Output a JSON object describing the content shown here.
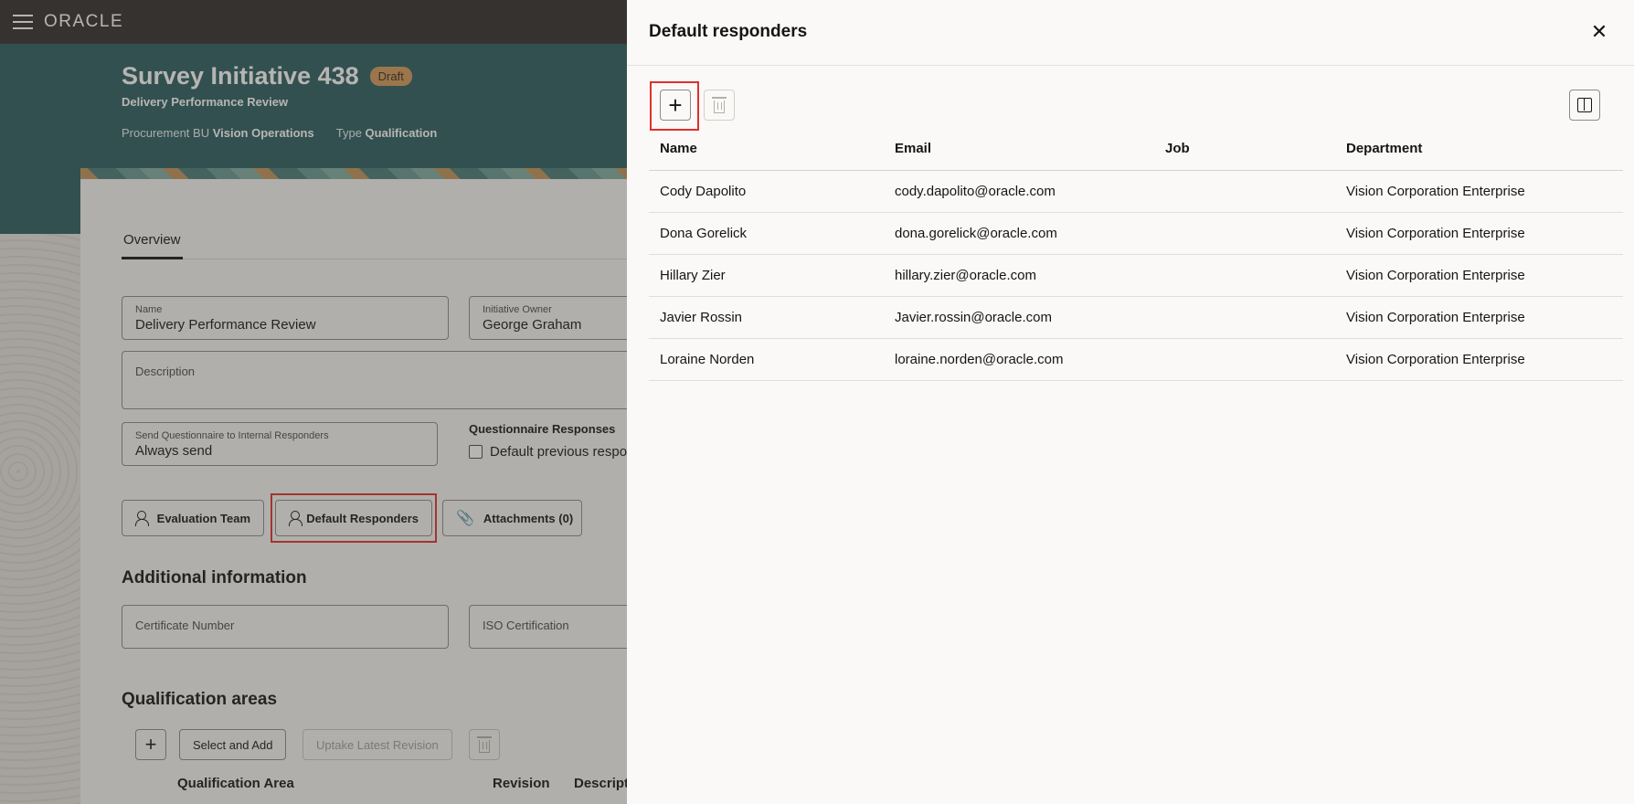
{
  "app": {
    "brand": "ORACLE"
  },
  "header": {
    "title": "Survey Initiative 438",
    "status": "Draft",
    "subtitle": "Delivery Performance Review",
    "meta": [
      {
        "label": "Procurement BU",
        "value": "Vision Operations"
      },
      {
        "label": "Type",
        "value": "Qualification"
      }
    ]
  },
  "tabs": [
    {
      "label": "Overview"
    }
  ],
  "form": {
    "name": {
      "label": "Name",
      "value": "Delivery Performance Review"
    },
    "owner": {
      "label": "Initiative Owner",
      "value": "George Graham"
    },
    "description": {
      "label": "Description"
    },
    "send": {
      "label": "Send Questionnaire to Internal Responders",
      "value": "Always send"
    },
    "responses": {
      "label": "Questionnaire Responses",
      "checkbox": "Default previous respo"
    }
  },
  "actions": {
    "evaluation_team": "Evaluation Team",
    "default_responders": "Default Responders",
    "attachments": "Attachments (0)"
  },
  "additional": {
    "title": "Additional information",
    "certificate": "Certificate Number",
    "iso": "ISO Certification"
  },
  "qualification": {
    "title": "Qualification areas",
    "select_add": "Select and Add",
    "uptake": "Uptake Latest Revision",
    "columns": [
      "Qualification Area",
      "Revision",
      "Descript"
    ]
  },
  "drawer": {
    "title": "Default responders",
    "columns": [
      "Name",
      "Email",
      "Job",
      "Department"
    ],
    "rows": [
      {
        "name": "Cody Dapolito",
        "email": "cody.dapolito@oracle.com",
        "job": "",
        "department": "Vision Corporation Enterprise"
      },
      {
        "name": "Dona Gorelick",
        "email": "dona.gorelick@oracle.com",
        "job": "",
        "department": "Vision Corporation Enterprise"
      },
      {
        "name": "Hillary Zier",
        "email": "hillary.zier@oracle.com",
        "job": "",
        "department": "Vision Corporation Enterprise"
      },
      {
        "name": "Javier Rossin",
        "email": "Javier.rossin@oracle.com",
        "job": "",
        "department": "Vision Corporation Enterprise"
      },
      {
        "name": "Loraine Norden",
        "email": "loraine.norden@oracle.com",
        "job": "",
        "department": "Vision Corporation Enterprise"
      }
    ]
  },
  "colors": {
    "hero": "#2b5d5f",
    "topbar": "#312d2a",
    "badge": "#d39a5b",
    "highlight": "#e0302c"
  }
}
